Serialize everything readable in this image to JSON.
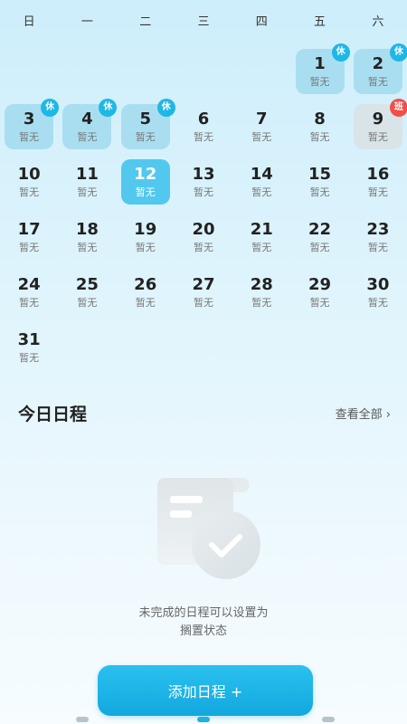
{
  "weekdays": [
    "日",
    "一",
    "二",
    "三",
    "四",
    "五",
    "六"
  ],
  "calendar": {
    "days": [
      {
        "num": "",
        "sub": "",
        "type": "empty"
      },
      {
        "num": "",
        "sub": "",
        "type": "empty"
      },
      {
        "num": "",
        "sub": "",
        "type": "empty"
      },
      {
        "num": "",
        "sub": "",
        "type": "empty"
      },
      {
        "num": "",
        "sub": "",
        "type": "empty"
      },
      {
        "num": "1",
        "sub": "暂无",
        "type": "holiday",
        "badge": "休"
      },
      {
        "num": "2",
        "sub": "暂无",
        "type": "holiday",
        "badge": "休"
      },
      {
        "num": "3",
        "sub": "暂无",
        "type": "holiday",
        "badge": "休"
      },
      {
        "num": "4",
        "sub": "暂无",
        "type": "holiday",
        "badge": "休"
      },
      {
        "num": "5",
        "sub": "暂无",
        "type": "holiday",
        "badge": "休"
      },
      {
        "num": "6",
        "sub": "暂无",
        "type": "normal"
      },
      {
        "num": "7",
        "sub": "暂无",
        "type": "normal"
      },
      {
        "num": "8",
        "sub": "暂无",
        "type": "normal"
      },
      {
        "num": "9",
        "sub": "暂无",
        "type": "workday",
        "badge": "班"
      },
      {
        "num": "10",
        "sub": "暂无",
        "type": "normal"
      },
      {
        "num": "11",
        "sub": "暂无",
        "type": "normal"
      },
      {
        "num": "12",
        "sub": "暂无",
        "type": "selected"
      },
      {
        "num": "13",
        "sub": "暂无",
        "type": "normal"
      },
      {
        "num": "14",
        "sub": "暂无",
        "type": "normal"
      },
      {
        "num": "15",
        "sub": "暂无",
        "type": "normal"
      },
      {
        "num": "16",
        "sub": "暂无",
        "type": "normal"
      },
      {
        "num": "17",
        "sub": "暂无",
        "type": "normal"
      },
      {
        "num": "18",
        "sub": "暂无",
        "type": "normal"
      },
      {
        "num": "19",
        "sub": "暂无",
        "type": "normal"
      },
      {
        "num": "20",
        "sub": "暂无",
        "type": "normal"
      },
      {
        "num": "21",
        "sub": "暂无",
        "type": "normal"
      },
      {
        "num": "22",
        "sub": "暂无",
        "type": "normal"
      },
      {
        "num": "23",
        "sub": "暂无",
        "type": "normal"
      },
      {
        "num": "24",
        "sub": "暂无",
        "type": "normal"
      },
      {
        "num": "25",
        "sub": "暂无",
        "type": "normal"
      },
      {
        "num": "26",
        "sub": "暂无",
        "type": "normal"
      },
      {
        "num": "27",
        "sub": "暂无",
        "type": "normal"
      },
      {
        "num": "28",
        "sub": "暂无",
        "type": "normal"
      },
      {
        "num": "29",
        "sub": "暂无",
        "type": "normal"
      },
      {
        "num": "30",
        "sub": "暂无",
        "type": "normal"
      },
      {
        "num": "31",
        "sub": "暂无",
        "type": "normal"
      }
    ]
  },
  "schedule": {
    "title": "今日日程",
    "view_all": "查看全部 ›",
    "empty_line1": "未完成的日程可以设置为",
    "empty_line2": "搁置状态",
    "add_button": "添加日程 +"
  },
  "colors": {
    "accent": "#1fb1e4",
    "holiday_bg": "#a9def1",
    "workday_badge": "#f0504a",
    "selected_bg": "#52c8ee"
  },
  "icons": {
    "empty_illustration": "document-check-icon"
  }
}
